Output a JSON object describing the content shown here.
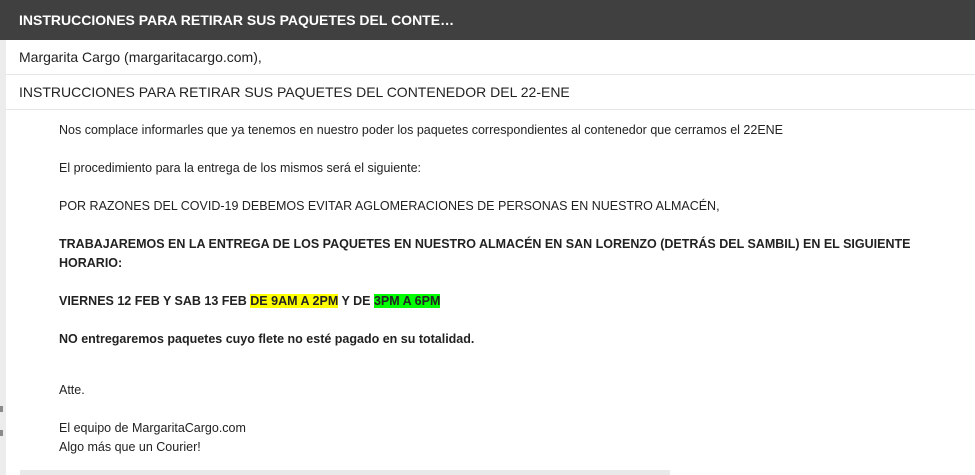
{
  "window": {
    "title": "INSTRUCCIONES PARA RETIRAR SUS PAQUETES DEL CONTE…"
  },
  "email": {
    "sender": "Margarita Cargo (margaritacargo.com),",
    "subject": "INSTRUCCIONES PARA RETIRAR SUS PAQUETES DEL CONTENEDOR DEL 22-ENE",
    "body": {
      "p1": "Nos complace informarles que ya tenemos en nuestro poder los paquetes correspondientes al contenedor que cerramos el 22ENE",
      "p2": "El procedimiento para la entrega de los mismos será el siguiente:",
      "p3": "POR RAZONES DEL COVID-19 DEBEMOS EVITAR AGLOMERACIONES DE PERSONAS EN NUESTRO ALMACÉN,",
      "p4_line1": "TRABAJAREMOS EN LA ENTREGA DE LOS PAQUETES EN NUESTRO ALMACÉN EN SAN LORENZO (DETRÁS DEL SAMBIL) EN EL SIGUIENTE",
      "p4_line2": "HORARIO:",
      "p5_prefix": "VIERNES 12 FEB Y SAB 13 FEB ",
      "p5_highlight1": "DE 9AM A 2PM",
      "p5_middle": " Y DE ",
      "p5_highlight2": "3PM A 6PM",
      "p6": "NO entregaremos paquetes cuyo flete no esté pagado en su totalidad.",
      "sign_off": "Atte.",
      "signature_line1": "El equipo de MargaritaCargo.com",
      "signature_line2": "Algo más que un Courier!"
    }
  },
  "colors": {
    "title_bar_bg": "#404040",
    "highlight_yellow": "#ffff00",
    "highlight_green": "#00ff00"
  }
}
